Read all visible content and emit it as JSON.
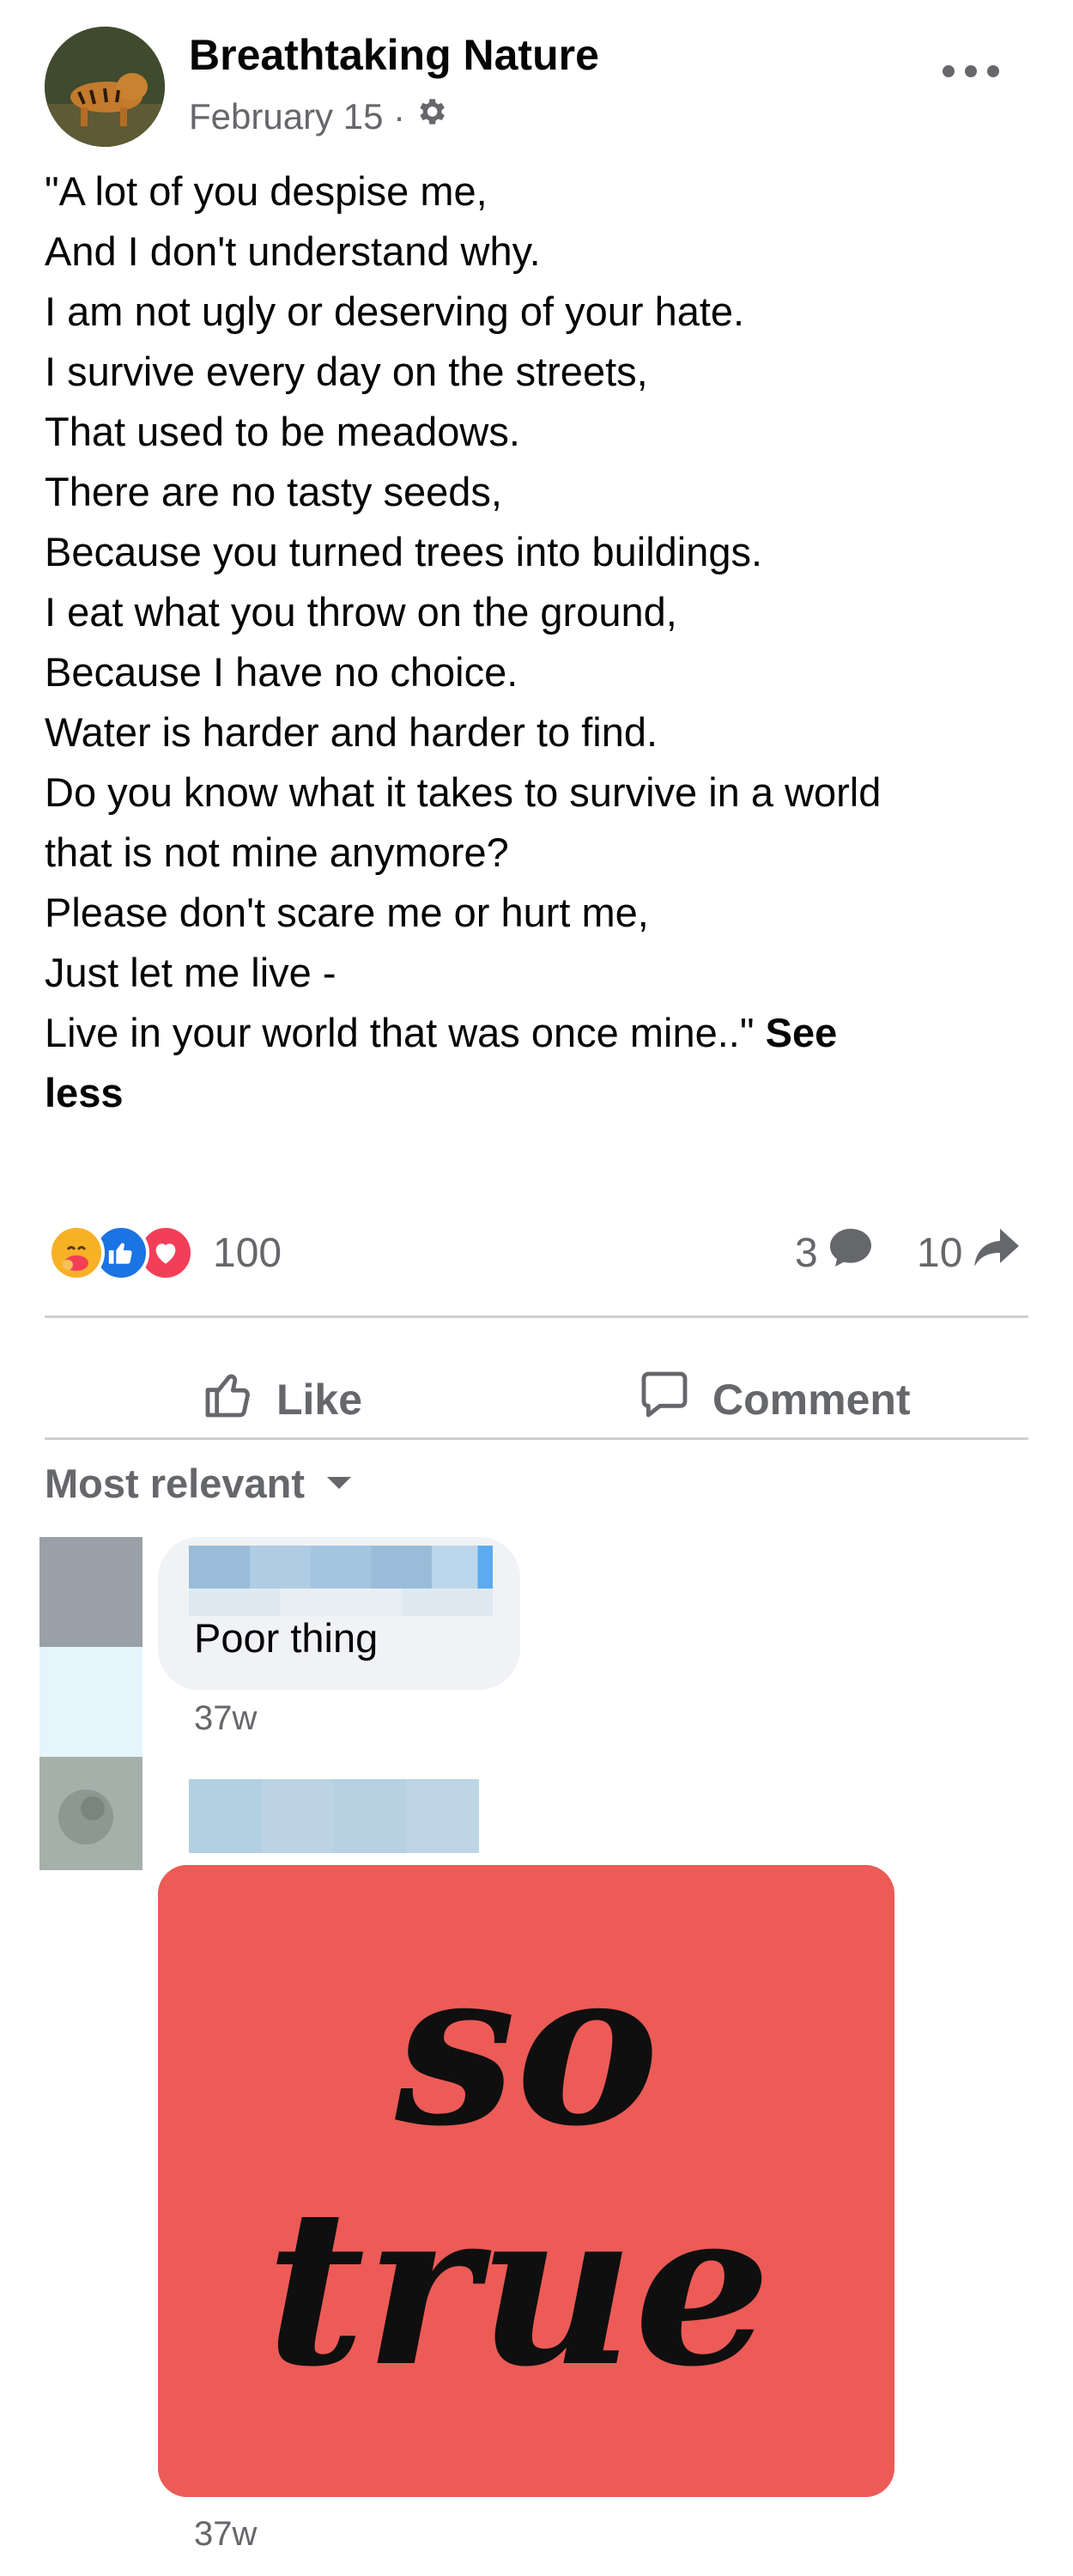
{
  "post": {
    "page_name": "Breathtaking Nature",
    "date": "February 15 ·",
    "audience_icon": "gear-icon",
    "more_icon": "ellipsis-icon",
    "text_lines": [
      "\"A lot of you despise me,",
      "And I don't understand why.",
      "I am not ugly or deserving of your hate.",
      "I survive every day on the streets,",
      "That used to be meadows.",
      "There are no tasty seeds,",
      "Because you turned trees into buildings.",
      "I eat what you throw on the ground,",
      "Because I have no choice.",
      "Water is harder and harder to find.",
      "Do you know what it takes to survive in a world",
      "that is not mine anymore?",
      "Please don't scare me or hurt me,",
      "Just let me live -",
      "Live in your world that was once mine..\""
    ],
    "see_less_part1": "See",
    "see_less_part2": "less"
  },
  "reactions": {
    "icons": [
      "care-emoji-icon",
      "like-icon",
      "love-icon"
    ],
    "count": "100",
    "comments_count": "3",
    "shares_count": "10"
  },
  "actions": {
    "like_label": "Like",
    "comment_label": "Comment"
  },
  "comments": {
    "sort_label": "Most relevant",
    "items": [
      {
        "text": "Poor thing",
        "time": "37w"
      },
      {
        "gif_text_line1": "so",
        "gif_text_line2": "true",
        "time": "37w"
      }
    ]
  },
  "colors": {
    "secondary_text": "#65676b",
    "like_blue": "#1b74e4",
    "love_red": "#f33e58",
    "care_yellow": "#f7b125",
    "gif_background": "#ec5b56"
  }
}
